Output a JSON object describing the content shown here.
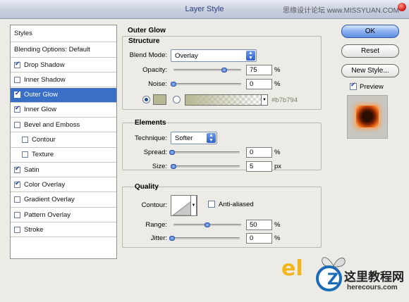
{
  "window": {
    "title": "Layer Style",
    "watermark": "思缘设计论坛 www.MISSYUAN.COM"
  },
  "styles_list": {
    "header": "Styles",
    "blending": "Blending Options: Default",
    "items": [
      {
        "label": "Drop Shadow",
        "checked": true,
        "indent": false,
        "selected": false
      },
      {
        "label": "Inner Shadow",
        "checked": false,
        "indent": false,
        "selected": false
      },
      {
        "label": "Outer Glow",
        "checked": true,
        "indent": false,
        "selected": true
      },
      {
        "label": "Inner Glow",
        "checked": true,
        "indent": false,
        "selected": false
      },
      {
        "label": "Bevel and Emboss",
        "checked": false,
        "indent": false,
        "selected": false
      },
      {
        "label": "Contour",
        "checked": false,
        "indent": true,
        "selected": false
      },
      {
        "label": "Texture",
        "checked": false,
        "indent": true,
        "selected": false
      },
      {
        "label": "Satin",
        "checked": true,
        "indent": false,
        "selected": false
      },
      {
        "label": "Color Overlay",
        "checked": true,
        "indent": false,
        "selected": false
      },
      {
        "label": "Gradient Overlay",
        "checked": false,
        "indent": false,
        "selected": false
      },
      {
        "label": "Pattern Overlay",
        "checked": false,
        "indent": false,
        "selected": false
      },
      {
        "label": "Stroke",
        "checked": false,
        "indent": false,
        "selected": false
      }
    ]
  },
  "outer_glow": {
    "title": "Outer Glow",
    "structure": {
      "title": "Structure",
      "blend_mode_label": "Blend Mode:",
      "blend_mode": "Overlay",
      "opacity_label": "Opacity:",
      "opacity": "75",
      "opacity_level": 0.75,
      "noise_label": "Noise:",
      "noise": "0",
      "noise_level": 0.0,
      "color_hex": "#b7b794",
      "color": "#b7b794"
    },
    "elements": {
      "title": "Elements",
      "technique_label": "Technique:",
      "technique": "Softer",
      "spread_label": "Spread:",
      "spread": "0",
      "spread_level": 0.0,
      "size_label": "Size:",
      "size": "5",
      "size_level": 0.02
    },
    "quality": {
      "title": "Quality",
      "contour_label": "Contour:",
      "anti_aliased_label": "Anti-aliased",
      "anti_aliased": false,
      "range_label": "Range:",
      "range": "50",
      "range_level": 0.5,
      "jitter_label": "Jitter:",
      "jitter": "0",
      "jitter_level": 0.0
    },
    "units": {
      "percent": "%",
      "px": "px"
    }
  },
  "buttons": {
    "ok": "OK",
    "reset": "Reset",
    "new_style": "New Style...",
    "preview_label": "Preview",
    "preview_checked": true
  },
  "logo": {
    "el": "el",
    "z": "Z",
    "cn": "这里教程网",
    "url": "herecours.com"
  },
  "colors": {
    "selection": "#3a6fc6",
    "accent": "#2b5fcd",
    "glow": "#b7b794"
  }
}
